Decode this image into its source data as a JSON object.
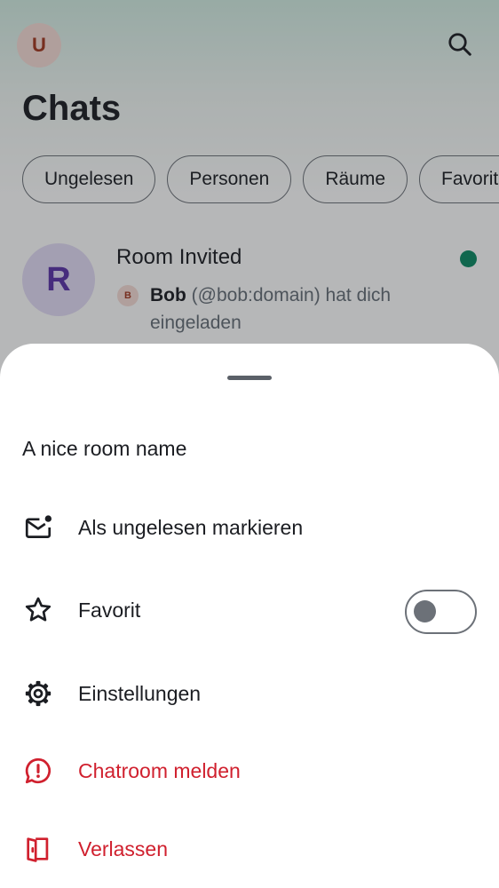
{
  "user_avatar_initial": "U",
  "page_title": "Chats",
  "filters": [
    "Ungelesen",
    "Personen",
    "Räume",
    "Favoriten"
  ],
  "room": {
    "avatar_initial": "R",
    "name": "Room Invited",
    "inviter_initial": "B",
    "inviter_name": "Bob",
    "invite_rest": "(@bob:domain) hat dich",
    "invite_rest_2": "eingeladen",
    "unread_color": "#0b8a64"
  },
  "sheet": {
    "title": "A nice room name",
    "items": [
      {
        "label": "Als ungelesen markieren",
        "icon": "mail-unread-icon"
      },
      {
        "label": "Favorit",
        "icon": "star-icon",
        "toggle_on": false
      },
      {
        "label": "Einstellungen",
        "icon": "gear-icon"
      },
      {
        "label": "Chatroom melden",
        "icon": "report-icon",
        "danger": true
      },
      {
        "label": "Verlassen",
        "icon": "leave-door-icon",
        "danger": true
      }
    ]
  },
  "colors": {
    "danger": "#d0202e",
    "text": "#1b1d22",
    "muted": "#656d77"
  }
}
